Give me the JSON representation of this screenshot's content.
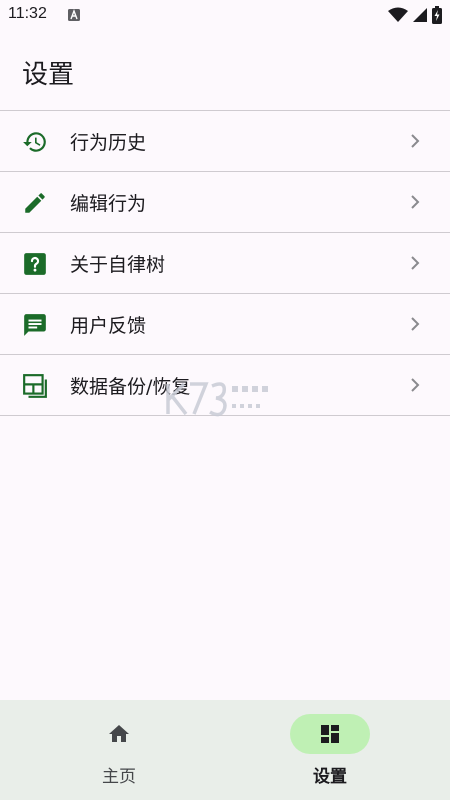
{
  "status_bar": {
    "time": "11:32",
    "notification_icon": "a-badge-icon",
    "wifi_icon": "wifi-icon",
    "signal_icon": "signal-icon",
    "battery_icon": "battery-charging-icon"
  },
  "header": {
    "title": "设置"
  },
  "menu": {
    "accent_color": "#1b6b29",
    "items": [
      {
        "label": "行为历史",
        "icon": "history-icon"
      },
      {
        "label": "编辑行为",
        "icon": "pencil-icon"
      },
      {
        "label": "关于自律树",
        "icon": "help-square-icon"
      },
      {
        "label": "用户反馈",
        "icon": "feedback-message-icon"
      },
      {
        "label": "数据备份/恢复",
        "icon": "backup-restore-icon"
      }
    ]
  },
  "bottom_nav": {
    "active_color": "#bff0b4",
    "items": [
      {
        "label": "主页",
        "icon": "home-icon",
        "active": false
      },
      {
        "label": "设置",
        "icon": "dashboard-icon",
        "active": true
      }
    ]
  }
}
